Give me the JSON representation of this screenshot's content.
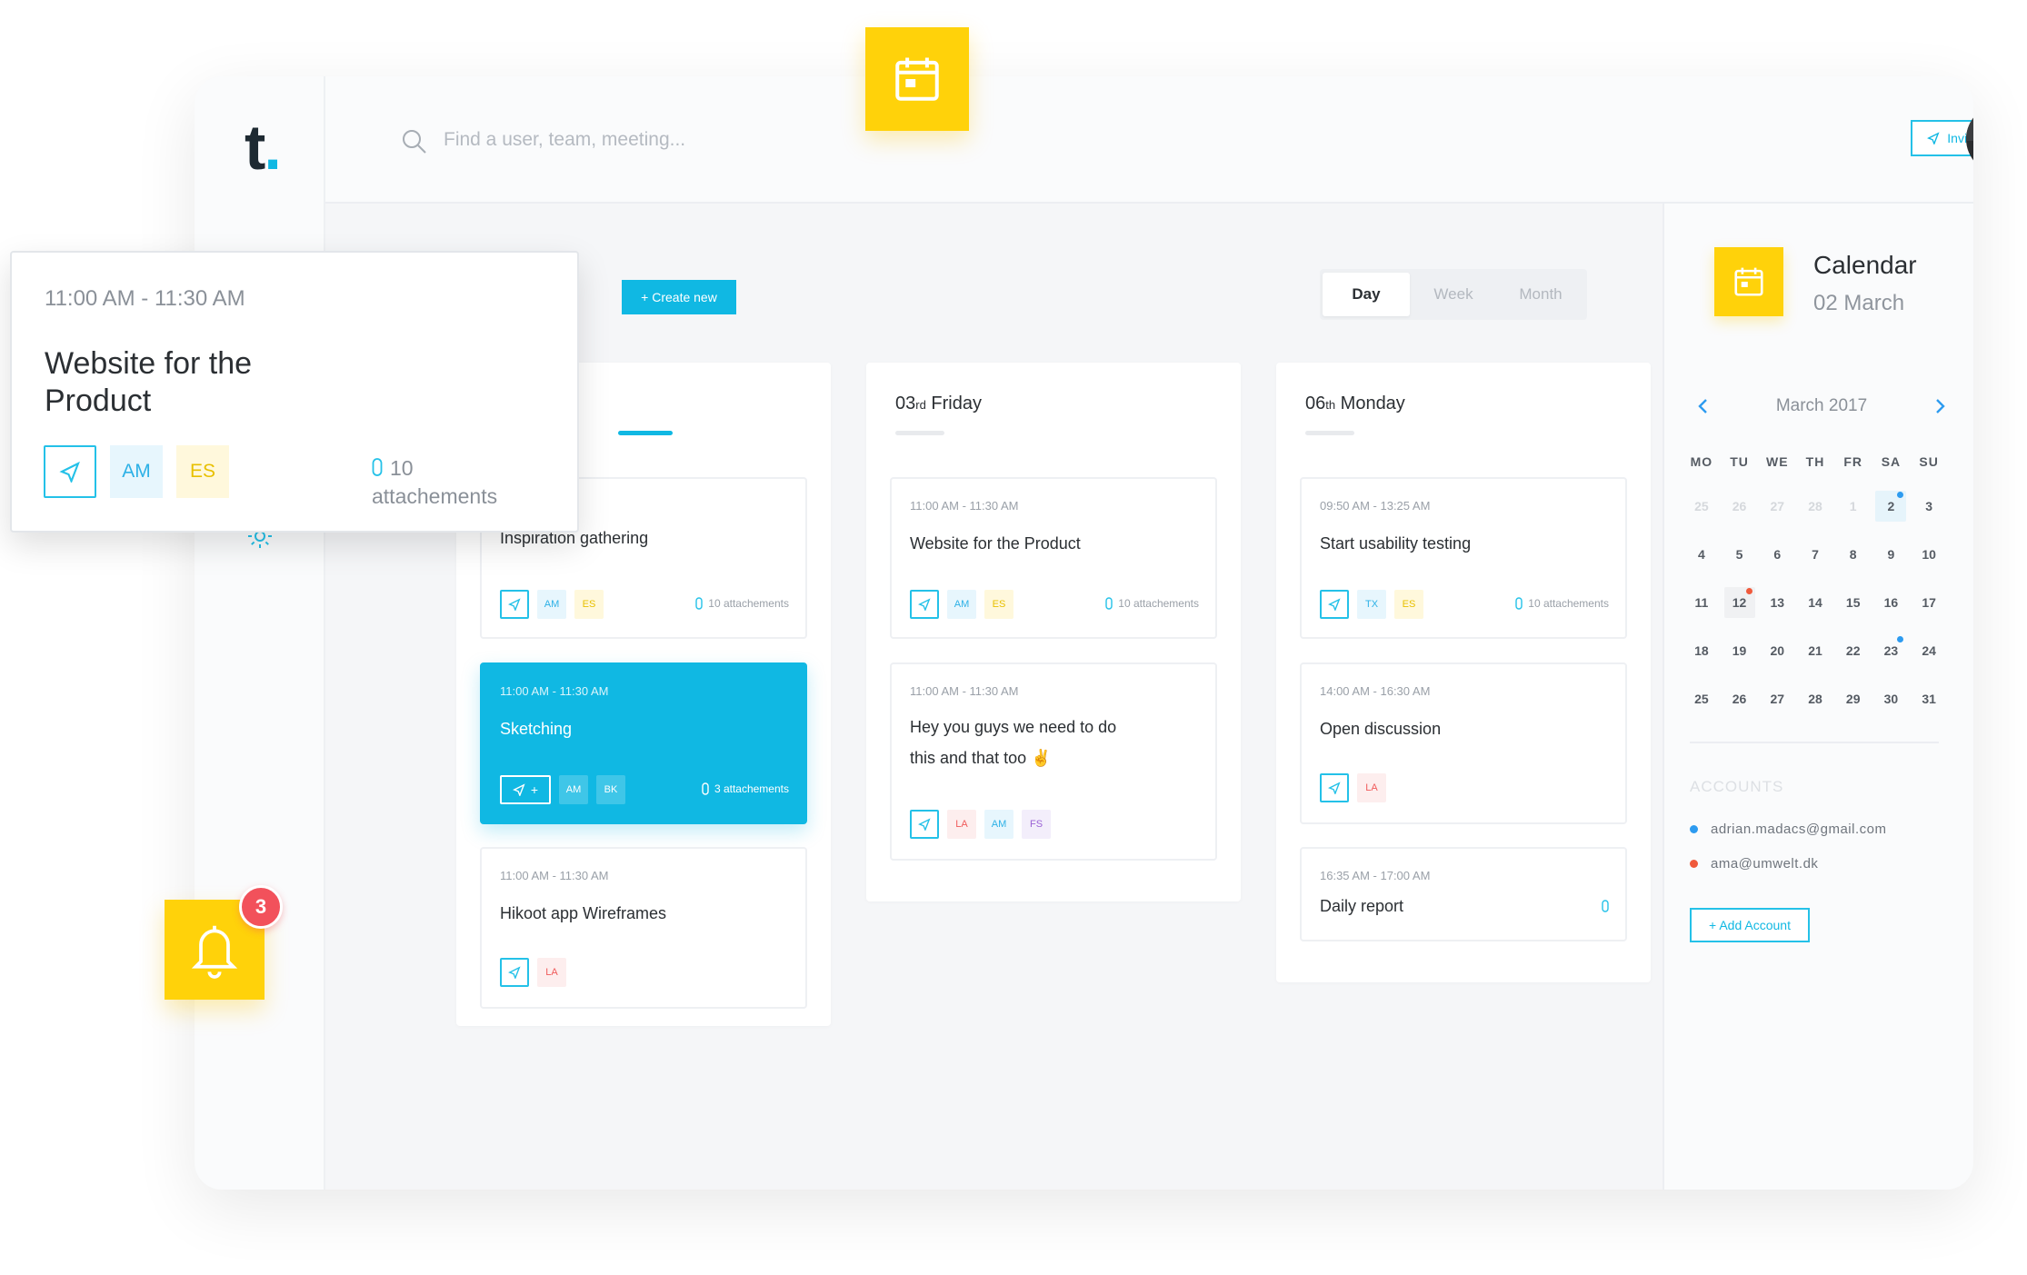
{
  "app": {
    "logo_letter": "t",
    "logo_dot": ".",
    "search_placeholder": "Find a user, team, meeting...",
    "invite_label": "Invite"
  },
  "toolbar": {
    "create_label": "+ Create new",
    "views": [
      "Day",
      "Week",
      "Month"
    ],
    "active_view": "Day"
  },
  "columns": [
    {
      "day": "",
      "suffix": "",
      "weekday": "",
      "cards": [
        {
          "time": "",
          "title": "Inspiration gathering",
          "tags": [
            "AM",
            "ES"
          ],
          "attachments": "10 attachements"
        },
        {
          "time": "11:00 AM - 11:30 AM",
          "title": "Sketching",
          "tags": [
            "AM",
            "BK"
          ],
          "attachments": "3 attachements",
          "send_extra": "+"
        },
        {
          "time": "11:00 AM - 11:30 AM",
          "title": "Hikoot app Wireframes",
          "tags": [
            "LA"
          ]
        }
      ]
    },
    {
      "day": "03",
      "suffix": "rd",
      "weekday": "Friday",
      "cards": [
        {
          "time": "11:00 AM - 11:30 AM",
          "title": "Website for the Product",
          "tags": [
            "AM",
            "ES"
          ],
          "attachments": "10 attachements"
        },
        {
          "time": "11:00 AM - 11:30 AM",
          "title": "Hey you guys we need to do this and that too ✌",
          "tags": [
            "LA",
            "AM",
            "FS"
          ]
        }
      ]
    },
    {
      "day": "06",
      "suffix": "th",
      "weekday": "Monday",
      "cards": [
        {
          "time": "09:50 AM - 13:25 AM",
          "title": "Start usability testing",
          "tags": [
            "TX",
            "ES"
          ],
          "attachments": "10 attachements"
        },
        {
          "time": "14:00 AM - 16:30 AM",
          "title": "Open discussion",
          "tags": [
            "LA"
          ]
        },
        {
          "time": "16:35 AM - 17:00 AM",
          "title": "Daily report"
        }
      ]
    }
  ],
  "calendar": {
    "title": "Calendar",
    "date": "02 March",
    "month_label": "March 2017",
    "weekdays": [
      "MO",
      "TU",
      "WE",
      "TH",
      "FR",
      "SA",
      "SU"
    ],
    "days": [
      [
        "25",
        "26",
        "27",
        "28",
        "1",
        "2",
        "3"
      ],
      [
        "4",
        "5",
        "6",
        "7",
        "8",
        "9",
        "10"
      ],
      [
        "11",
        "12",
        "13",
        "14",
        "15",
        "16",
        "17"
      ],
      [
        "18",
        "19",
        "20",
        "21",
        "22",
        "23",
        "24"
      ],
      [
        "25",
        "26",
        "27",
        "28",
        "29",
        "30",
        "31"
      ]
    ],
    "selected_day": "2",
    "highlighted_day": "12"
  },
  "accounts": {
    "heading": "ACCOUNTS",
    "items": [
      {
        "email": "adrian.madacs@gmail.com",
        "color": "#2d9bf0"
      },
      {
        "email": "ama@umwelt.dk",
        "color": "#f05a3c"
      }
    ],
    "add_label": "+ Add Account"
  },
  "popup": {
    "time": "11:00 AM - 11:30 AM",
    "title": "Website for the Product",
    "tags": [
      "AM",
      "ES"
    ],
    "attach_count": "10",
    "attach_word": "attachements"
  },
  "notifications": {
    "count": "3"
  },
  "colors": {
    "accent": "#10b8e3",
    "yellow": "#ffd20a",
    "badge": "#f2515b"
  }
}
